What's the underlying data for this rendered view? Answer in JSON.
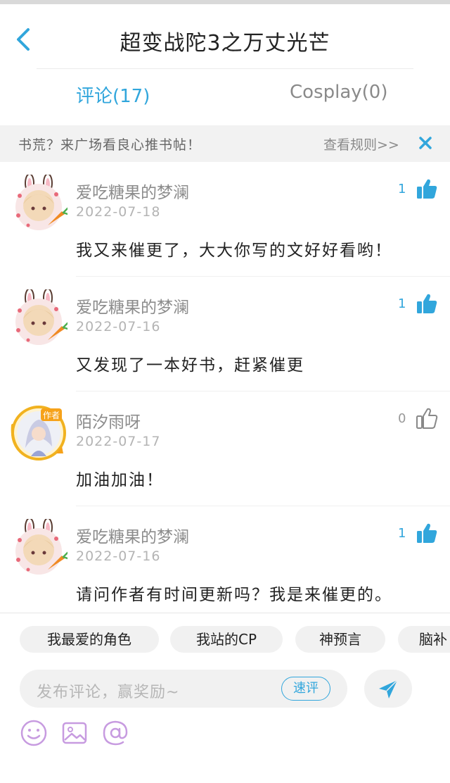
{
  "header": {
    "title": "超变战陀3之万丈光芒"
  },
  "tabs": [
    {
      "label": "评论(17)",
      "active": true
    },
    {
      "label": "Cosplay(0)",
      "active": false
    }
  ],
  "notice": {
    "text": "书荒？来广场看良心推书帖！",
    "rules_link": "查看规则>>"
  },
  "comments": [
    {
      "user": "爱吃糖果的梦澜",
      "date": "2022-07-18",
      "text": "我又来催更了，大大你写的文好好看哟！",
      "likes": "1",
      "liked": true,
      "avatar": "bunny-girl-avatar"
    },
    {
      "user": "爱吃糖果的梦澜",
      "date": "2022-07-16",
      "text": "又发现了一本好书，赶紧催更",
      "likes": "1",
      "liked": true,
      "avatar": "bunny-girl-avatar"
    },
    {
      "user": "陌汐雨呀",
      "date": "2022-07-17",
      "text": "加油加油！",
      "likes": "0",
      "liked": false,
      "avatar": "author-badge-avatar",
      "badge": "作者"
    },
    {
      "user": "爱吃糖果的梦澜",
      "date": "2022-07-16",
      "text": "请问作者有时间更新吗？我是来催更的。",
      "likes": "1",
      "liked": true,
      "avatar": "bunny-girl-avatar"
    }
  ],
  "quick_tags": [
    "我最爱的角色",
    "我站的CP",
    "神预言",
    "脑补"
  ],
  "composer": {
    "placeholder": "发布评论，赢奖励~",
    "quick_review_label": "速评"
  },
  "colors": {
    "accent": "#31a6dc",
    "tool_icons": "#c79be0",
    "muted_text": "#8c8c8c"
  }
}
